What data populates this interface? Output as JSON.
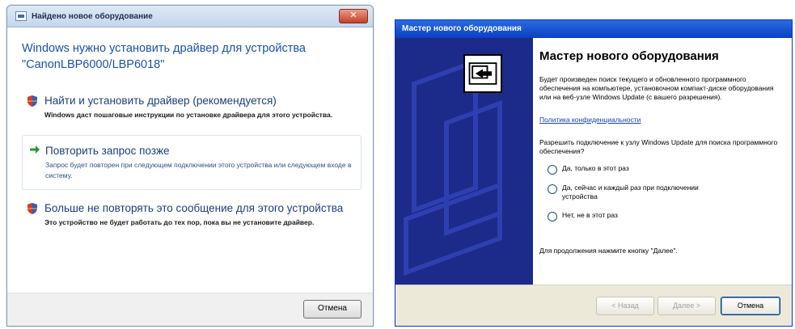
{
  "vista_dialog": {
    "title": "Найдено новое оборудование",
    "heading": "Windows нужно установить драйвер для устройства \"CanonLBP6000/LBP6018\"",
    "options": [
      {
        "title": "Найти и установить драйвер (рекомендуется)",
        "description": "Windows даст пошаговые инструкции по установке драйвера для этого устройства."
      },
      {
        "title": "Повторить запрос позже",
        "description": "Запрос будет повторен при следующем подключении этого устройства или следующем входе в систему."
      },
      {
        "title": "Больше не повторять это сообщение для этого устройства",
        "description": "Это устройство не будет работать до тех пор, пока вы не установите драйвер."
      }
    ],
    "cancel_label": "Отмена"
  },
  "xp_wizard": {
    "title": "Мастер нового оборудования",
    "heading": "Мастер нового оборудования",
    "intro": "Будет произведен поиск текущего и обновленного программного обеспечения на компьютере, установочном компакт-диске оборудования или на веб-узле Windows Update (с вашего разрешения).",
    "privacy_link": "Политика конфиденциальности",
    "question": "Разрешить подключение к узлу Windows Update для поиска программного обеспечения?",
    "radio_options": [
      "Да, только в этот раз",
      "Да, сейчас и каждый раз при подключении устройства",
      "Нет, не в этот раз"
    ],
    "continue_hint": "Для продолжения нажмите кнопку \"Далее\".",
    "buttons": {
      "back": "< Назад",
      "next": "Далее >",
      "cancel": "Отмена"
    }
  }
}
